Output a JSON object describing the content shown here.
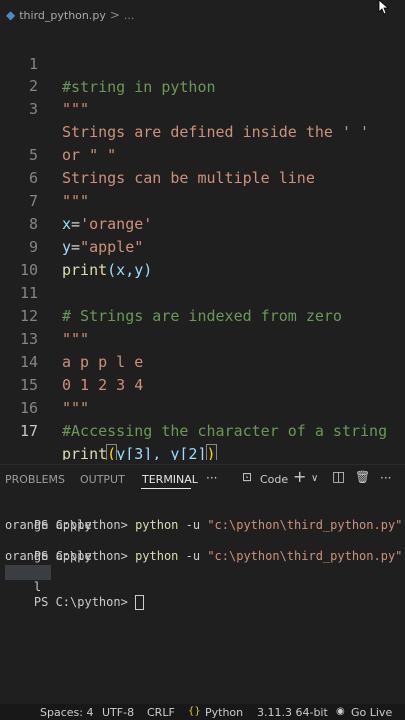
{
  "breadcrumb": {
    "file": "third_python.py",
    "separator": ">",
    "ellipsis": "..."
  },
  "editor": {
    "lines": [
      {
        "n": "1",
        "t": "#string in python"
      },
      {
        "n": "2",
        "t": "\"\"\""
      },
      {
        "n": "3",
        "t": "Strings are defined inside the ' '"
      },
      {
        "n": "",
        "t": "or \" \""
      },
      {
        "n": "5",
        "t": "Strings can be multiple line"
      },
      {
        "n": "6",
        "t": "\"\"\""
      },
      {
        "n": "7",
        "x": "x",
        "eq": "=",
        "v": "'orange'"
      },
      {
        "n": "8",
        "x": "y",
        "eq": "=",
        "v": "\"apple\""
      },
      {
        "n": "9",
        "fn": "print",
        "args": "(x,y)"
      },
      {
        "n": "10",
        "t": ""
      },
      {
        "n": "11",
        "t": "# Strings are indexed from zero"
      },
      {
        "n": "12",
        "t": "\"\"\""
      },
      {
        "n": "13",
        "t": "a p p l e"
      },
      {
        "n": "14",
        "t": "0 1 2 3 4"
      },
      {
        "n": "15",
        "t": "\"\"\""
      },
      {
        "n": "16",
        "t": "#Accessing the character of a string"
      },
      {
        "n": "17",
        "fn": "print",
        "a": "(",
        "b": "y[3], y[2]",
        "c": ")"
      }
    ]
  },
  "panel": {
    "tabs": [
      "PROBLEMS",
      "OUTPUT",
      "TERMINAL"
    ],
    "more": "···",
    "code_label": "Code",
    "plus": "+",
    "chevron": "∨",
    "split": "◫",
    "trash": "🗑",
    "dots": "···"
  },
  "terminal": {
    "prompt": "PS C:\\python> ",
    "cmd": "python",
    "flag": " -u ",
    "path": "\"c:\\python\\third_python.py\"",
    "out1": "orange apple",
    "out2": "orange apple",
    "out3": "l"
  },
  "status": {
    "spaces": "Spaces: 4",
    "enc": "UTF-8",
    "eol": "CRLF",
    "lang": "Python",
    "ver": "3.11.3 64-bit",
    "live": "Go Live"
  }
}
